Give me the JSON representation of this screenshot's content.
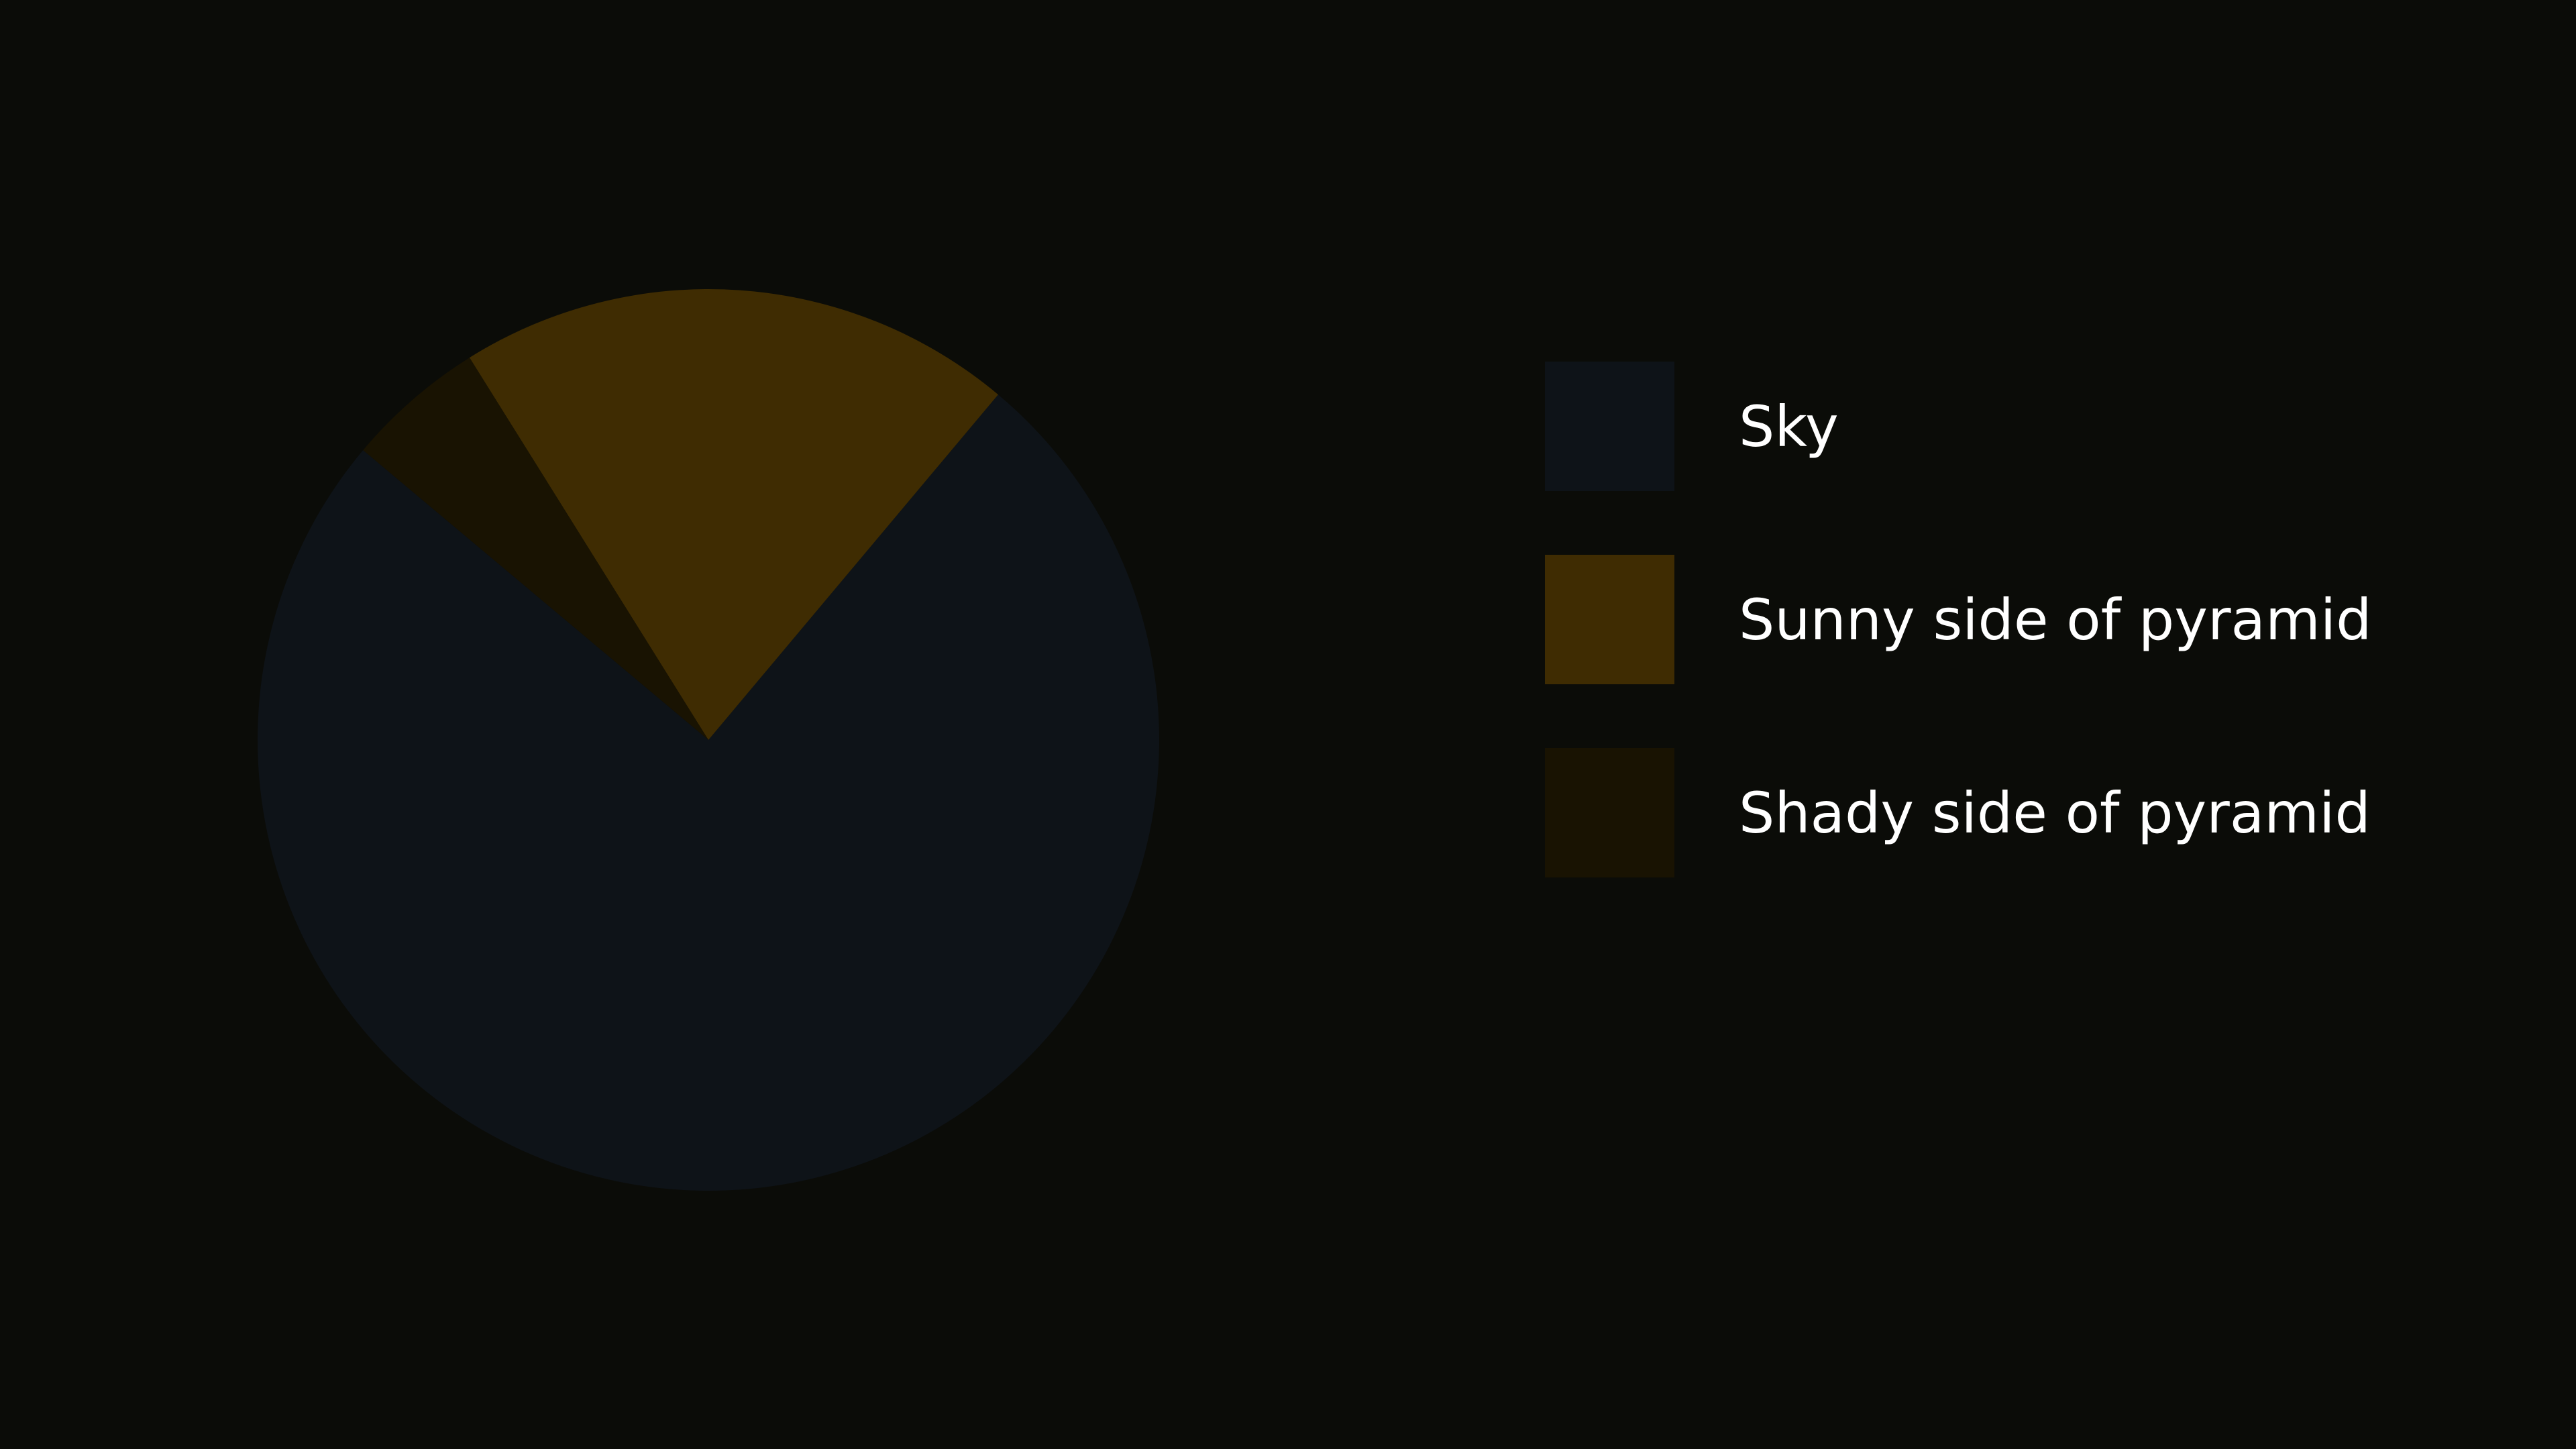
{
  "chart_data": {
    "type": "pie",
    "title": "",
    "labels": [
      "Sky",
      "Sunny side of pyramid",
      "Shady side of pyramid"
    ],
    "values": [
      75,
      20,
      5
    ],
    "colors": [
      "#0e1318",
      "#3f2c02",
      "#191302"
    ],
    "start_angle_deg": 140,
    "direction": "counterclockwise",
    "legend_position": "right"
  },
  "page": {
    "background": "#0b0c08"
  }
}
